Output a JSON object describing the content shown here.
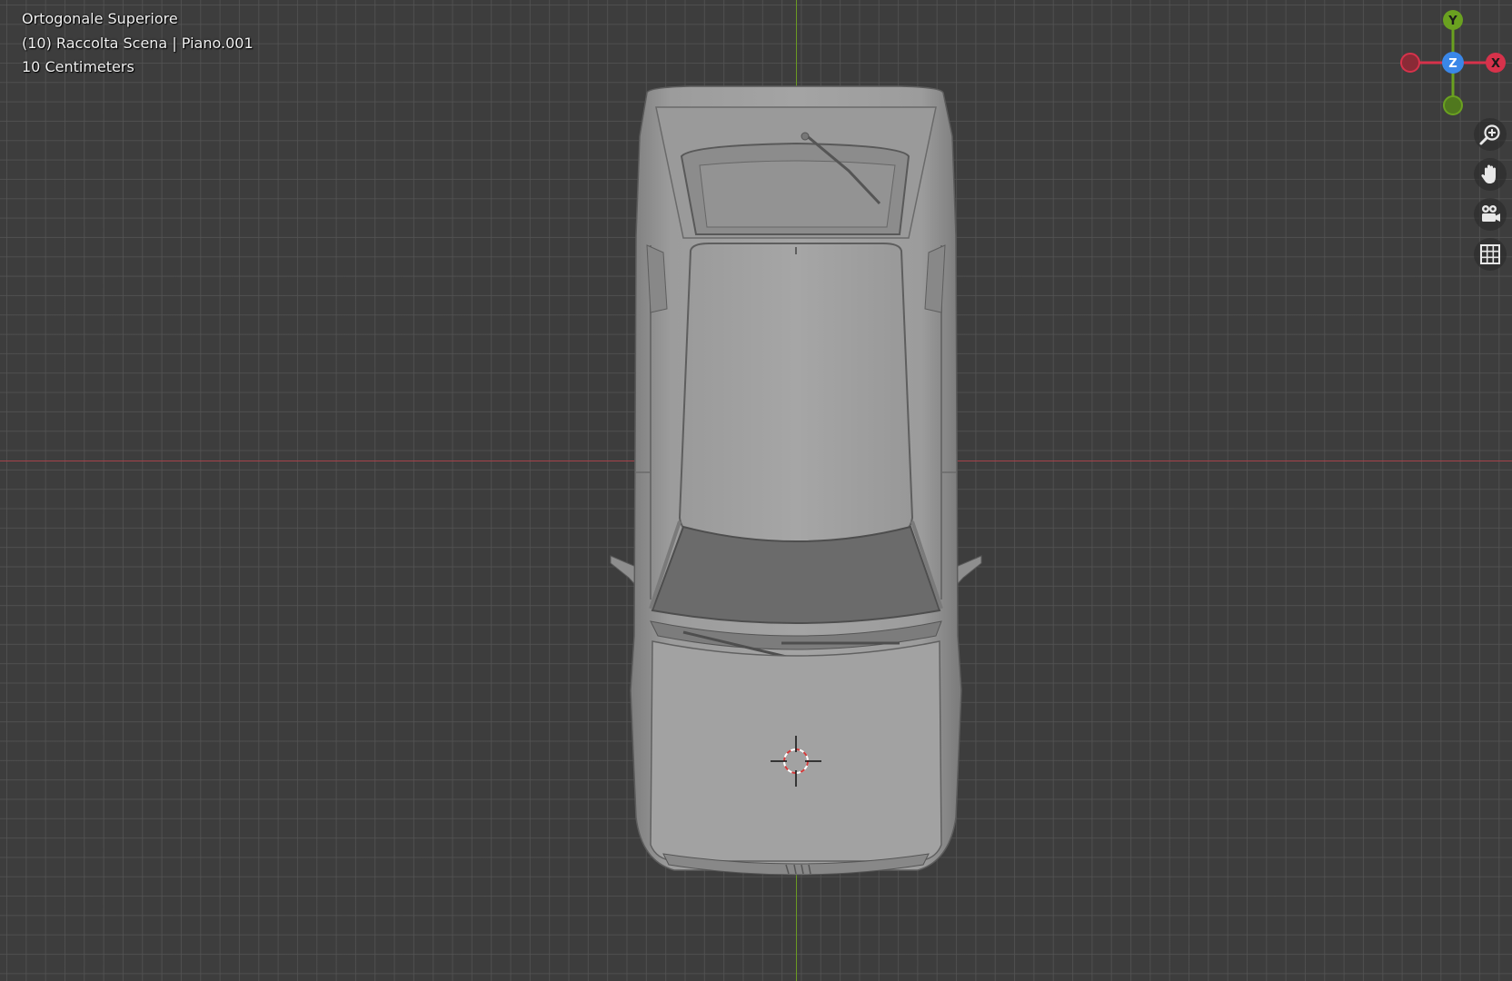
{
  "viewport": {
    "view_name": "Ortogonale Superiore",
    "collection_info": "(10) Raccolta Scena | Piano.001",
    "grid_scale": "10 Centimeters"
  },
  "gizmo": {
    "y_label": "Y",
    "z_label": "Z",
    "x_label": "X",
    "colors": {
      "x": "#d7324b",
      "y": "#6aa120",
      "z": "#3a87e8",
      "neg_x": "#8a2a36",
      "neg_y": "#50781e"
    }
  },
  "nav_tools": [
    {
      "name": "zoom",
      "icon": "zoom-in-icon"
    },
    {
      "name": "pan",
      "icon": "hand-icon"
    },
    {
      "name": "camera",
      "icon": "camera-icon"
    },
    {
      "name": "perspective-ortho",
      "icon": "grid-icon"
    }
  ],
  "colors": {
    "background": "#3d3d3d",
    "grid_line": "#555555",
    "axis_x": "#a5424a",
    "axis_y": "#6a9a22",
    "model": "#9e9e9e"
  }
}
